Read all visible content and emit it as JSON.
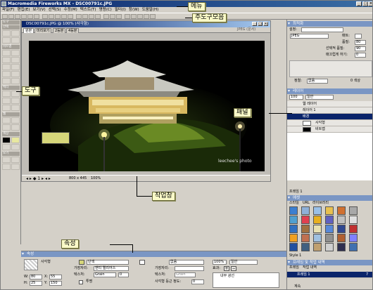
{
  "app": {
    "title": "Macromedia Fireworks MX - DSC00791c.JPG",
    "window_buttons": [
      "_",
      "□",
      "×"
    ]
  },
  "menu": [
    "파일(F)",
    "편집(E)",
    "보기(V)",
    "선택(S)",
    "수정(M)",
    "텍스트(T)",
    "명령(C)",
    "필터(I)",
    "창(W)",
    "도움말(H)"
  ],
  "left_tools": {
    "sections": [
      "도구",
      "선택",
      "비트맵",
      "벡터",
      "웹",
      "색상",
      "보기"
    ]
  },
  "document": {
    "title": "DSC00791c.JPG @ 100% (사각형)",
    "tabs": [
      "원본",
      "미리보기",
      "2등분",
      "4등분"
    ],
    "tabs_right": "JPEG (문서)",
    "photo_credit": "leechee's photo",
    "status": {
      "size": "800 x 445",
      "zoom": "100%"
    }
  },
  "right_panel": {
    "optimize": {
      "header": "최적화",
      "preset_label": "설정:",
      "format": "JPEG",
      "matte_label": "매트:",
      "quality_label": "품질:",
      "quality_value": "80",
      "selective_label": "선택적 품질:",
      "selective_value": "90",
      "smoothing_label": "매끄럽게 하기:",
      "smoothing_value": "0",
      "sort_label": "정렬:",
      "sort_value": "없음",
      "colors_label": "0 색상"
    },
    "layers": {
      "header": "레이어",
      "opacity_value": "100",
      "blend_value": "일반",
      "rows": [
        {
          "name": "웹 레이어"
        },
        {
          "name": "레이어 1"
        },
        {
          "name": "배경"
        },
        {
          "name": "사각형"
        },
        {
          "name": "비트맵"
        }
      ],
      "footer": "프레임 1"
    },
    "styles": {
      "header": "에셋",
      "tabs": [
        "스타일",
        "URL",
        "라이브러리"
      ],
      "style_label": "Style 1",
      "swatches": [
        "#3c7fd0",
        "#8fb0d8",
        "#9ac0e8",
        "#e8c050",
        "#d07030",
        "#a8a8a8",
        "#50a0d0",
        "#e04050",
        "#e8b020",
        "#6060c0",
        "#c0c0c0",
        "#e0e0e0",
        "#3070c0",
        "#a07040",
        "#e8e0b0",
        "#5888d8",
        "#304890",
        "#c03030",
        "#f0a020",
        "#c07050",
        "#a0c0e0",
        "#909090",
        "#b06030",
        "#8080ff",
        "#2050a0",
        "#406080",
        "#c0a070",
        "#d0d0d0",
        "#303050",
        "#4070b0"
      ]
    },
    "frames": {
      "header": "프레임 및 작업 내역",
      "tabs": [
        "프레임",
        "작업 내역"
      ],
      "row": "프레임 1",
      "row_value": "7",
      "footer": "계속"
    }
  },
  "properties": {
    "header": "속성",
    "object_type": "사각형",
    "fill_type": "단색",
    "edge_label": "가장자리:",
    "edge_value": "앤티 앨리어스",
    "texture_label": "텍스처:",
    "texture_value": "Grain",
    "texture_pct": "0",
    "stroke_type": "없음",
    "stroke_edge_label": "가장자리:",
    "stroke_texture_label": "텍스처:",
    "stroke_texture_value": "Grain",
    "roundness_label": "사각형 둥근 정도:",
    "roundness_value": "0",
    "opacity_value": "100%",
    "blend_value": "일반",
    "effects_label": "효과:",
    "effect_item": "내부 광선",
    "w_label": "W:",
    "w_value": "80",
    "h_label": "H:",
    "h_value": "25",
    "x_label": "X:",
    "x_value": "55",
    "y_label": "Y:",
    "y_value": "150",
    "transparent_label": "투명"
  },
  "callouts": {
    "menu": "메뉴",
    "toolbar": "주도구모음",
    "tools": "도구",
    "panels": "패널",
    "workspace": "작업창",
    "properties": "속성"
  },
  "colors": {
    "callout_bg": "#fafac8",
    "title_blue": "#0a246a",
    "panel_header": "#7a96c4",
    "selected_layer": "#0a246a",
    "selected_rect": "#d6d67a"
  }
}
